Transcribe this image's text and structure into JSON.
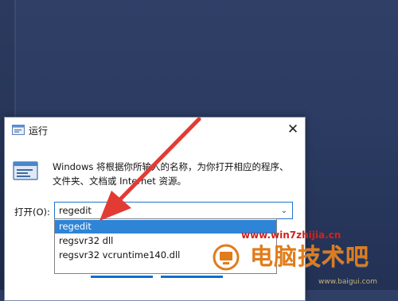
{
  "dialog": {
    "title": "运行",
    "description_line1": "Windows 将根据你所输入的名称，为你打开相应的程序、",
    "description_line2": "文件夹、文档或 Internet 资源。",
    "open_label": "打开(O):",
    "input_value": "regedit",
    "dropdown_items": [
      "regedit",
      "regsvr32 dll",
      "regsvr32 vcruntime140.dll"
    ],
    "selected_index": 0
  },
  "watermark": {
    "url": "www.win7zhijia.cn",
    "brand": "电脑技术吧",
    "sub": "www.baigui.com"
  },
  "colors": {
    "accent": "#1e75c8",
    "selection": "#2e84d6",
    "arrow": "#e23b33",
    "watermark_red": "#d5211b",
    "watermark_orange": "#e07c1a"
  }
}
